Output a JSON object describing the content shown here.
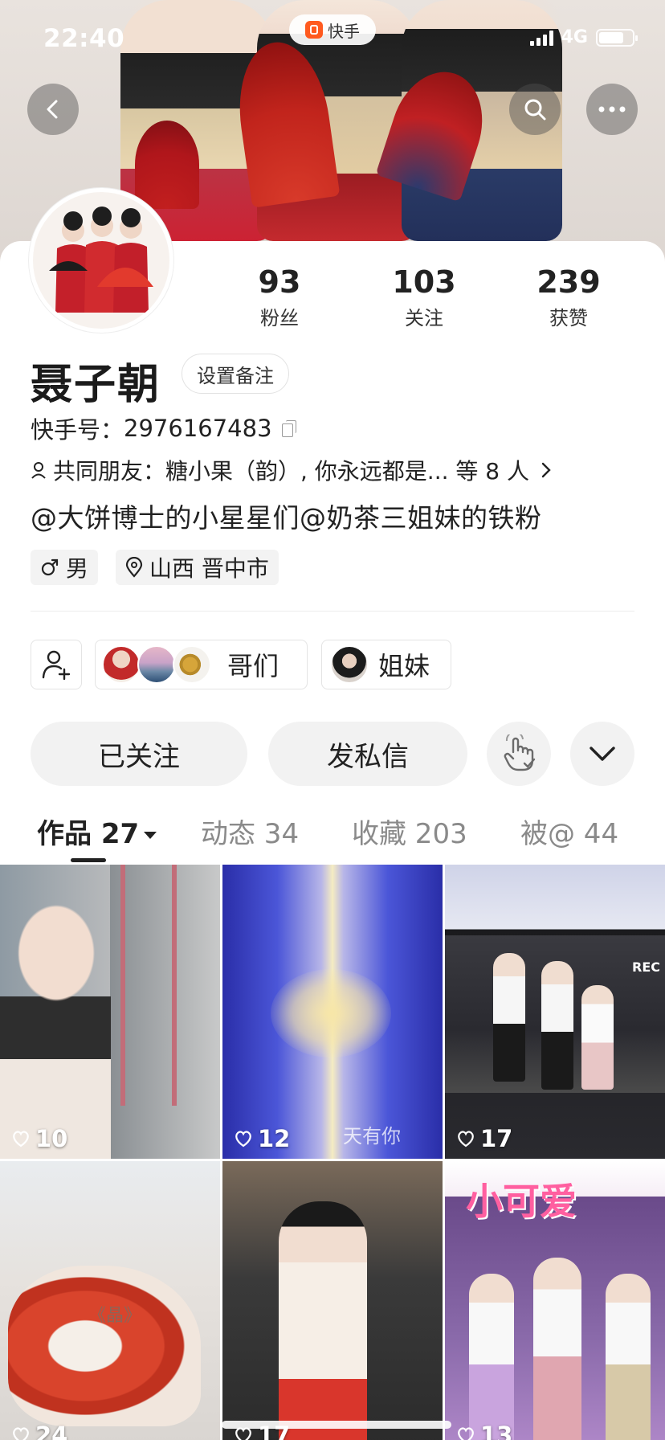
{
  "status_bar": {
    "time": "22:40",
    "network": "4G",
    "battery_level": 0.75
  },
  "app_badge": {
    "name": "快手"
  },
  "profile": {
    "name": "聂子朝",
    "remark_button": "设置备注",
    "kuaishou_id_label": "快手号：",
    "kuaishou_id": "2976167483",
    "mutual_friends": "共同朋友：糖小果（韵）, 你永远都是... 等 8 人",
    "bio": "@大饼博士的小星星们@奶茶三姐妹的铁粉",
    "gender": "男",
    "location": "山西 晋中市"
  },
  "stats": [
    {
      "value": "93",
      "label": "粉丝"
    },
    {
      "value": "103",
      "label": "关注"
    },
    {
      "value": "239",
      "label": "获赞"
    }
  ],
  "groups": [
    {
      "label": "哥们"
    },
    {
      "label": "姐妹"
    }
  ],
  "actions": {
    "follow": "已关注",
    "message": "发私信"
  },
  "tabs": [
    {
      "label": "作品 27"
    },
    {
      "label": "动态 34"
    },
    {
      "label": "收藏 203"
    },
    {
      "label": "被@ 44"
    }
  ],
  "videos": [
    {
      "likes": "10"
    },
    {
      "likes": "12",
      "overlay_text": "天有你"
    },
    {
      "likes": "17",
      "overlay_text": "REC"
    },
    {
      "likes": "24",
      "overlay_text": "《晶》"
    },
    {
      "likes": "17"
    },
    {
      "likes": "13",
      "overlay_text": "小可爱"
    }
  ],
  "colors": {
    "accent": "#ff5a1f",
    "text": "#222222",
    "muted": "#8a8a8a",
    "button_bg": "#f2f2f2"
  }
}
